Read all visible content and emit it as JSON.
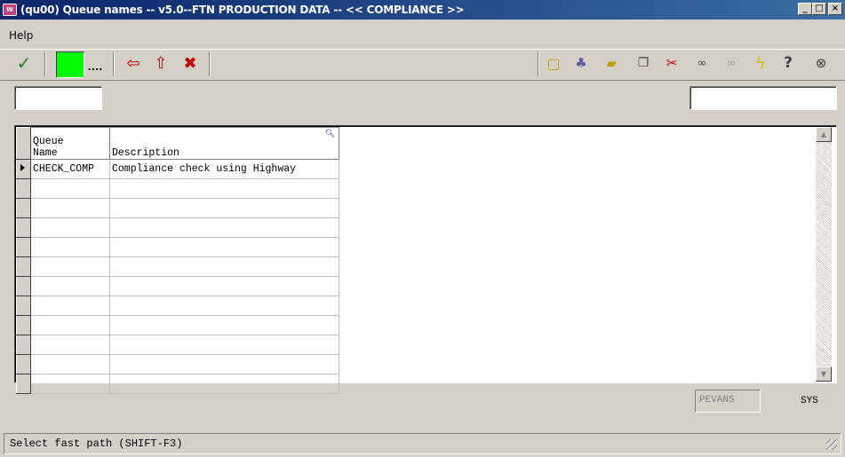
{
  "window": {
    "title": "(qu00) Queue names  -- v5.0--FTN PRODUCTION DATA -- << COMPLIANCE >>",
    "app_icon_text": "W",
    "buttons": {
      "minimize": "_",
      "maximize": "□",
      "close": "×"
    }
  },
  "menubar": {
    "help": "Help"
  },
  "toolbar": {
    "more_label": "....",
    "icons": [
      "check-icon",
      "green-field",
      "ellipsis",
      "back-1-icon",
      "up-2-icon",
      "delete-icon",
      "new-icon",
      "tree-icon",
      "open-folder-icon",
      "copy-icon",
      "cut-icon",
      "view-icon",
      "view-disabled-icon",
      "lightning-icon",
      "help-icon",
      "find-icon"
    ]
  },
  "fields": {
    "left_input": "",
    "right_input": ""
  },
  "grid": {
    "headers": [
      {
        "line1": "Queue",
        "line2": "Name"
      },
      {
        "line1": "",
        "line2": "Description"
      }
    ],
    "rows": [
      {
        "name": "CHECK_COMP",
        "description": "Compliance check using Highway"
      },
      {
        "name": "",
        "description": ""
      },
      {
        "name": "",
        "description": ""
      },
      {
        "name": "",
        "description": ""
      },
      {
        "name": "",
        "description": ""
      },
      {
        "name": "",
        "description": ""
      },
      {
        "name": "",
        "description": ""
      },
      {
        "name": "",
        "description": ""
      },
      {
        "name": "",
        "description": ""
      },
      {
        "name": "",
        "description": ""
      },
      {
        "name": "",
        "description": ""
      },
      {
        "name": "",
        "description": ""
      }
    ]
  },
  "footer": {
    "user": "PEVANS",
    "sys": "SYS"
  },
  "status": {
    "text": "Select fast path (SHIFT-F3)"
  },
  "colors": {
    "title_start": "#0a246a",
    "title_end": "#3a6ea5",
    "face": "#d4d0c8",
    "green": "#00ff00"
  }
}
